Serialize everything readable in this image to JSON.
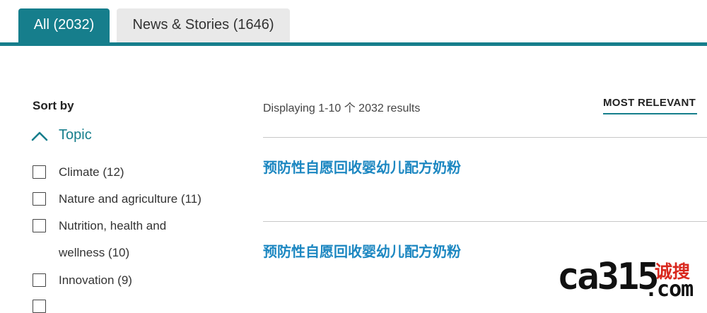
{
  "tabs": [
    {
      "label": "All (2032)",
      "active": true
    },
    {
      "label": "News & Stories (1646)",
      "active": false
    }
  ],
  "sidebar": {
    "sort_by_label": "Sort by",
    "facet": {
      "label": "Topic",
      "expanded": true,
      "icon": "chevron-up-icon",
      "options": [
        {
          "label": "Climate (12)",
          "checked": false
        },
        {
          "label": "Nature and agriculture (11)",
          "checked": false
        },
        {
          "label": "Nutrition, health and wellness (10)",
          "checked": false
        },
        {
          "label": "Innovation (9)",
          "checked": false
        }
      ]
    }
  },
  "results": {
    "info": "Displaying 1-10 个 2032 results",
    "sort_label": "MOST RELEVANT",
    "items": [
      {
        "title": "预防性自愿回收婴幼儿配方奶粉"
      },
      {
        "title": "预防性自愿回收婴幼儿配方奶粉"
      }
    ]
  },
  "watermark": {
    "logo_text": "ca315",
    "logo_cn": "诚搜",
    "logo_suffix": ".com"
  },
  "colors": {
    "accent": "#167e8c",
    "link": "#1c87c1",
    "watermark_red": "#d9281e"
  }
}
